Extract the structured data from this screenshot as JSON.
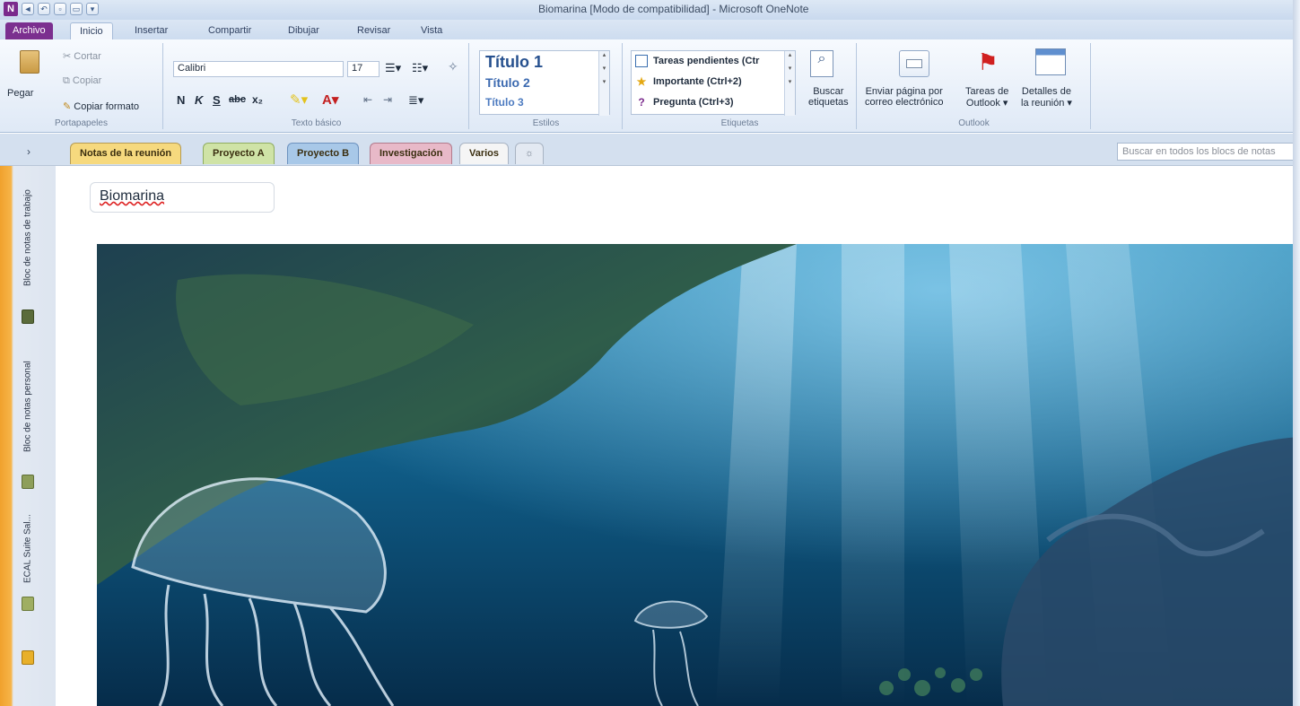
{
  "window": {
    "title": "Biomarina [Modo de compatibilidad] - Microsoft OneNote",
    "app_logo": "N"
  },
  "ribbon_tabs": [
    "Archivo",
    "Inicio",
    "Insertar",
    "Compartir",
    "Dibujar",
    "Revisar",
    "Vista"
  ],
  "clipboard": {
    "paste": "Pegar",
    "cut": "Cortar",
    "copy": "Copiar",
    "format_painter": "Copiar formato",
    "group": "Portapapeles"
  },
  "basic_text": {
    "font": "Calibri",
    "size": "17",
    "bold": "N",
    "italic": "K",
    "underline": "S",
    "strike": "abc",
    "subscript": "x₂",
    "group": "Texto básico"
  },
  "styles": {
    "h1": "Título 1",
    "h2": "Título 2",
    "h3": "Título 3",
    "group": "Estilos"
  },
  "tags": {
    "todo": "Tareas pendientes (Ctr",
    "important": "Importante (Ctrl+2)",
    "question": "Pregunta (Ctrl+3)",
    "find_tags_1": "Buscar",
    "find_tags_2": "etiquetas",
    "group": "Etiquetas"
  },
  "outlook": {
    "email_1": "Enviar página por",
    "email_2": "correo electrónico",
    "tasks_1": "Tareas de",
    "tasks_2": "Outlook",
    "meeting_1": "Detalles de",
    "meeting_2": "la reunión",
    "group": "Outlook"
  },
  "sections": [
    "Notas de la reunión",
    "Proyecto A",
    "Proyecto B",
    "Investigación",
    "Varios"
  ],
  "section_colors": [
    "#f6d97e",
    "#cfe3a6",
    "#a8c8e8",
    "#e8b9c8",
    "#f5f5f5"
  ],
  "search_placeholder": "Buscar en todos los blocs de notas",
  "notebooks": [
    "Bloc de notas de trabajo",
    "Bloc de notas personal",
    "ECAL Suite Sal..."
  ],
  "page": {
    "title": "Biomarina"
  }
}
